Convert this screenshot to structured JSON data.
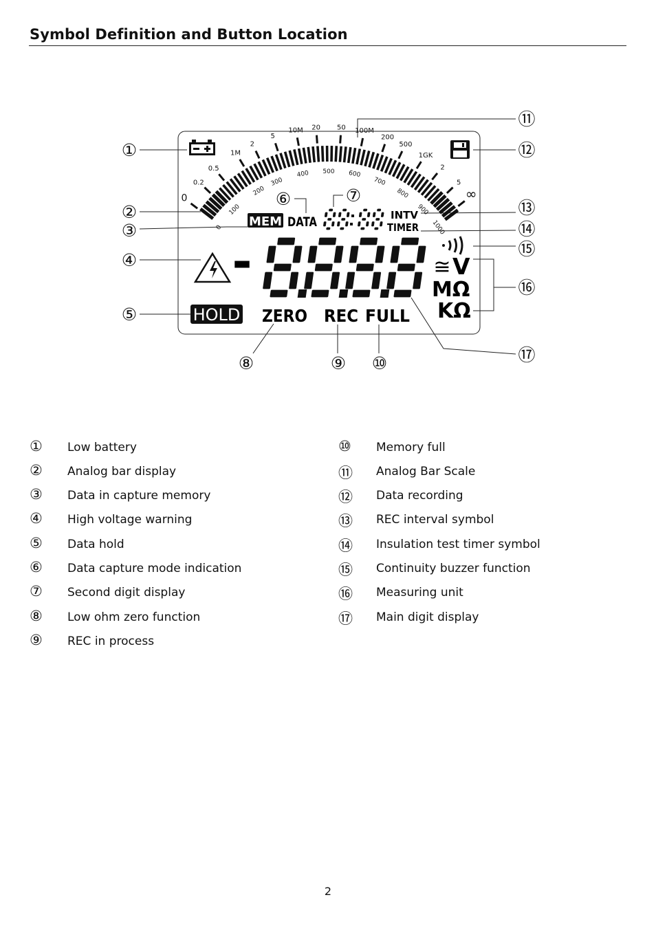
{
  "header": {
    "title": "Symbol Definition and Button Location"
  },
  "lcd": {
    "outer_scale": [
      "0",
      "0.2",
      "0.5",
      "1M",
      "2",
      "5",
      "10M",
      "20",
      "50",
      "100M",
      "200",
      "500",
      "1GK",
      "2",
      "5",
      "∞"
    ],
    "inner_scale": [
      "0",
      "100",
      "200",
      "300",
      "400",
      "500",
      "600",
      "700",
      "800",
      "900",
      "1000"
    ],
    "mem": "MEM",
    "data": "DATA",
    "intv": "INTV",
    "timer": "TIMER",
    "hold": "HOLD",
    "zero": "ZERO",
    "rec": "REC",
    "full": "FULL",
    "unit_v": "V",
    "unit_mohm": "MΩ",
    "unit_kohm": "KΩ",
    "acdc_symbol": "≅",
    "minus_sign": "-",
    "icons": [
      "battery-icon",
      "floppy-disk-icon",
      "high-voltage-warning-icon",
      "buzzer-icon"
    ]
  },
  "callouts": [
    "①",
    "②",
    "③",
    "④",
    "⑤",
    "⑥",
    "⑦",
    "⑧",
    "⑨",
    "⑩",
    "⑪",
    "⑫",
    "⑬",
    "⑭",
    "⑮",
    "⑯",
    "⑰"
  ],
  "legend": {
    "left": [
      {
        "num": "①",
        "text": "Low battery"
      },
      {
        "num": "②",
        "text": "Analog bar display"
      },
      {
        "num": "③",
        "text": "Data in capture memory"
      },
      {
        "num": "④",
        "text": "High voltage warning"
      },
      {
        "num": "⑤",
        "text": "Data hold"
      },
      {
        "num": "⑥",
        "text": "Data capture mode indication"
      },
      {
        "num": "⑦",
        "text": "Second digit display"
      },
      {
        "num": "⑧",
        "text": "Low ohm zero function"
      },
      {
        "num": "⑨",
        "text": "REC in process"
      }
    ],
    "right": [
      {
        "num": "⑩",
        "text": "Memory full"
      },
      {
        "num": "⑪",
        "text": "Analog Bar Scale"
      },
      {
        "num": "⑫",
        "text": "Data recording"
      },
      {
        "num": "⑬",
        "text": "REC interval symbol"
      },
      {
        "num": "⑭",
        "text": "Insulation test timer symbol"
      },
      {
        "num": "⑮",
        "text": "Continuity buzzer function"
      },
      {
        "num": "⑯",
        "text": "Measuring unit"
      },
      {
        "num": "⑰",
        "text": "Main digit display"
      }
    ]
  },
  "footer": {
    "page_number": "2"
  }
}
